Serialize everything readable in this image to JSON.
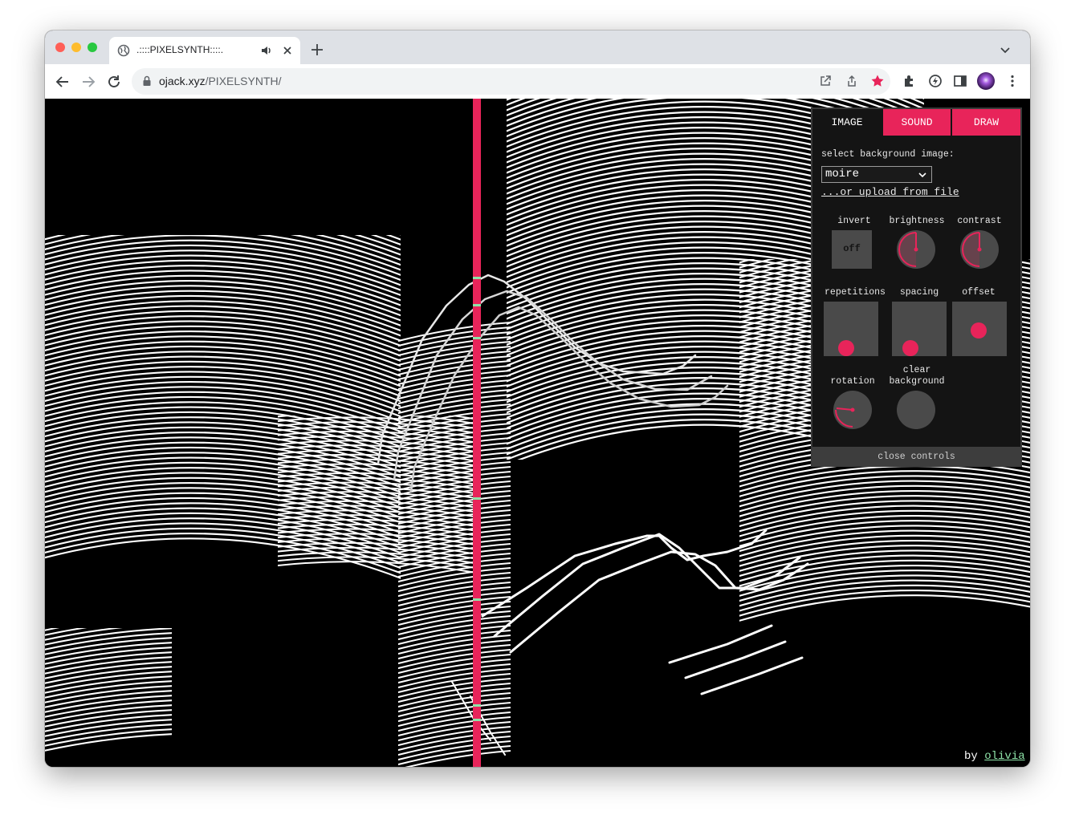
{
  "browser": {
    "tab_title": ".::::PIXELSYNTH::::.",
    "url_host": "ojack.xyz",
    "url_path": "/PIXELSYNTH/",
    "icons": [
      "globe-icon",
      "speaker-icon",
      "close-icon",
      "plus-icon",
      "chevron-down-icon",
      "back-icon",
      "forward-icon",
      "reload-icon",
      "lock-icon",
      "open-external-icon",
      "share-icon",
      "star-icon",
      "extensions-icon",
      "extension-icon",
      "side-panel-icon",
      "profile-avatar",
      "menu-icon"
    ]
  },
  "colors": {
    "accent": "#e8245a",
    "panel": "#141414",
    "control": "#4a4a4a",
    "link_green": "#8ee3a8"
  },
  "controls": {
    "tabs": [
      "IMAGE",
      "SOUND",
      "DRAW"
    ],
    "active_tab": "IMAGE",
    "select_label": "select background image:",
    "selected_image": "moire",
    "upload_link": "...or upload from file",
    "invert_label": "invert",
    "invert_value": "off",
    "brightness_label": "brightness",
    "contrast_label": "contrast",
    "repetitions_label": "repetitions",
    "spacing_label": "spacing",
    "offset_label": "offset",
    "rotation_label": "rotation",
    "clear_label_1": "clear",
    "clear_label_2": "background",
    "close_label": "close controls"
  },
  "credit": {
    "prefix": "by",
    "name": "olivia"
  }
}
